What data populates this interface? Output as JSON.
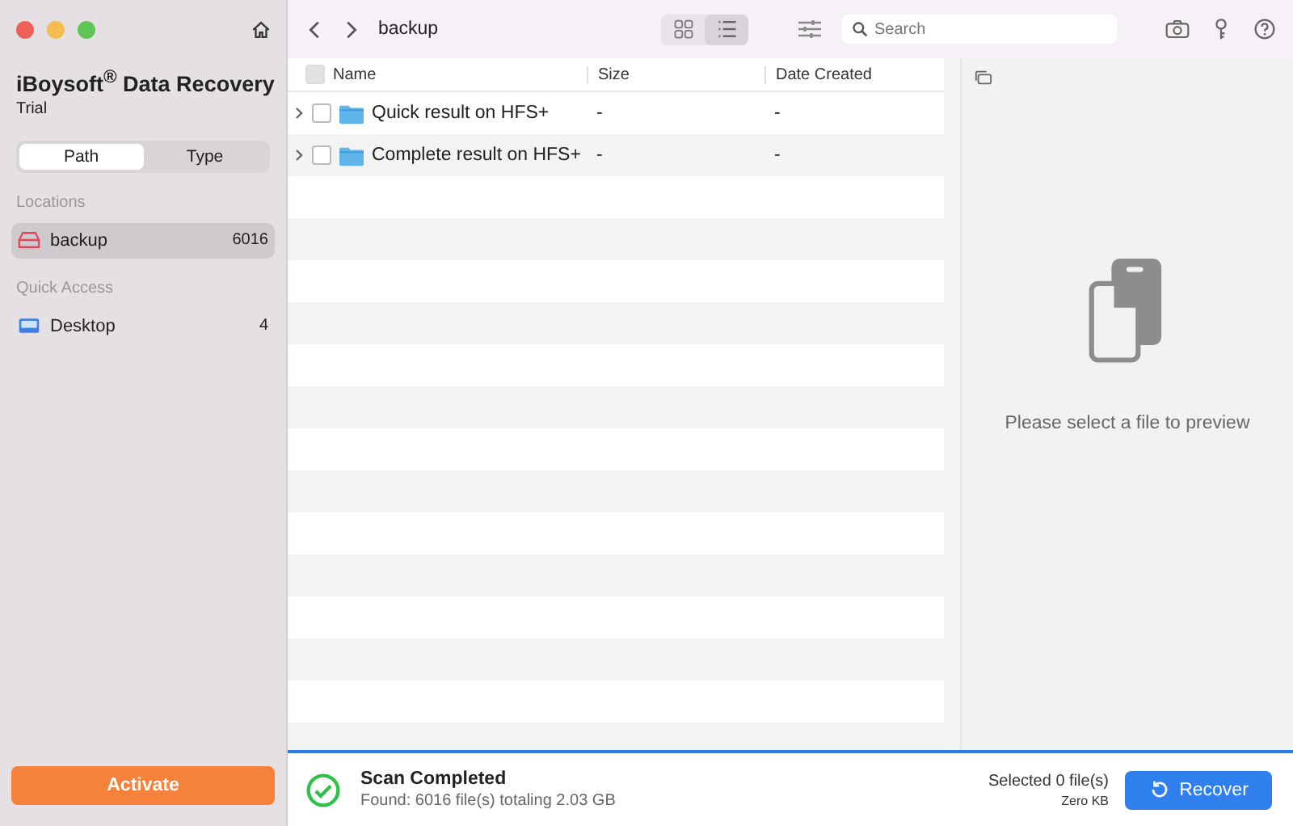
{
  "app": {
    "title": "iBoysoft$^{®}$ Data Recovery",
    "edition": "Trial"
  },
  "segments": [
    {
      "label": "Path",
      "selected": true
    },
    {
      "label": "Type",
      "selected": false
    }
  ],
  "sidebar": {
    "sections": [
      {
        "heading": "Locations",
        "items": [
          {
            "kind": "drive",
            "label": "backup",
            "count": "6016",
            "selected": true
          }
        ]
      },
      {
        "heading": "Quick Access",
        "items": [
          {
            "kind": "desktop",
            "label": "Desktop",
            "count": "4",
            "selected": false
          }
        ]
      }
    ]
  },
  "activate_button": "Activate",
  "toolbar": {
    "path": "backup",
    "views": [
      {
        "kind": "grid",
        "selected": false
      },
      {
        "kind": "list",
        "selected": true
      }
    ],
    "search": {
      "placeholder": "Search"
    }
  },
  "table": {
    "select_all": false,
    "columns": [
      "Name",
      "Size",
      "Date Created"
    ],
    "rows": [
      {
        "name": "Quick result on HFS+",
        "size": "-",
        "date": "-",
        "checked": false
      },
      {
        "name": "Complete result on HFS+",
        "size": "-",
        "date": "-",
        "checked": false
      }
    ]
  },
  "preview": {
    "message": "Please select a file to preview"
  },
  "status": {
    "title": "Scan Completed",
    "detail": "Found: 6016 file(s) totaling 2.03 GB",
    "selected": "Selected 0 file(s)",
    "size": "Zero KB",
    "recover_button": "Recover"
  }
}
